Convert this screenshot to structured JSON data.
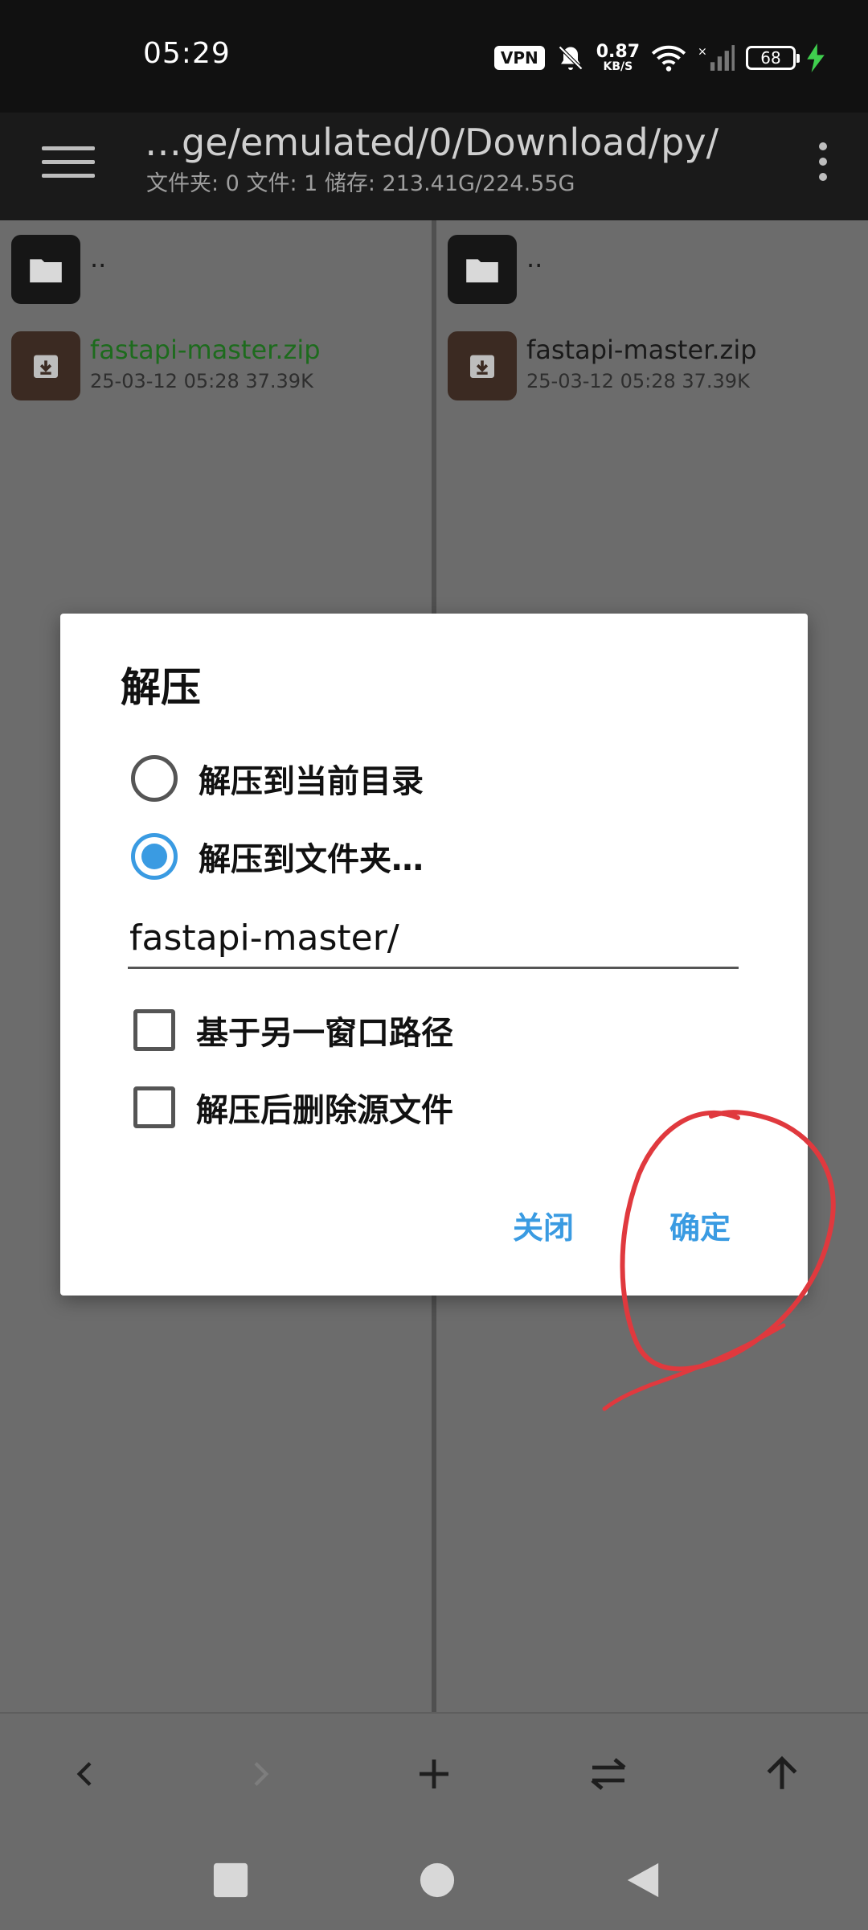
{
  "status_bar": {
    "time": "05:29",
    "vpn": "VPN",
    "speed_value": "0.87",
    "speed_unit": "KB/S",
    "battery": "68"
  },
  "toolbar": {
    "path": "…ge/emulated/0/Download/py/",
    "info": "文件夹: 0  文件: 1  储存: 213.41G/224.55G",
    "menu_icon": "hamburger-icon",
    "overflow_icon": "kebab-icon"
  },
  "panes": {
    "left": {
      "parent": "..",
      "file_name": "fastapi-master.zip",
      "file_meta": "25-03-12 05:28  37.39K"
    },
    "right": {
      "parent": "..",
      "file_name": "fastapi-master.zip",
      "file_meta": "25-03-12 05:28  37.39K"
    }
  },
  "dialog": {
    "title": "解压",
    "option_current": "解压到当前目录",
    "option_folder": "解压到文件夹…",
    "folder_value": "fastapi-master/",
    "check_other_window": "基于另一窗口路径",
    "check_delete_source": "解压后删除源文件",
    "close_label": "关闭",
    "confirm_label": "确定"
  },
  "colors": {
    "accent": "#3a9be2",
    "annotation": "#e0393e",
    "highlight_file": "#1d6b1d"
  }
}
